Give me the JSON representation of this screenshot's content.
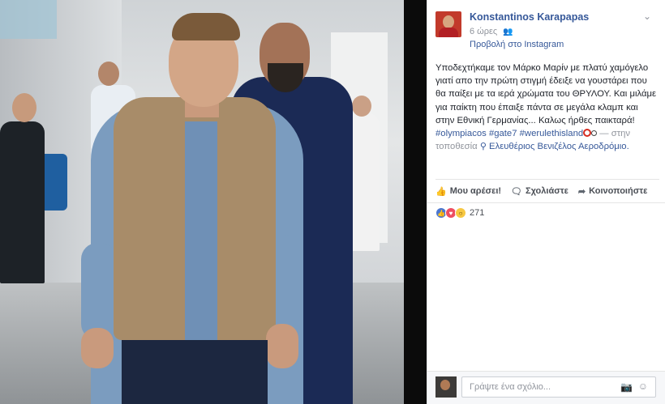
{
  "post": {
    "author": "Konstantinos Karapapas",
    "time": "6 ώρες",
    "via": "Προβολή στο Instagram",
    "text_main": "Υποδεχτήκαμε τον Μάρκο Μαρίν με πλατύ χαμόγελο γιατί απο την πρώτη στιγμή έδειξε να γουστάρει που θα παίξει με τα ιερά χρώματα του ΘΡΥΛΟΥ. Και μιλάμε για παίκτη που έπαιξε πάντα σε μεγάλα κλαμπ και στην Εθνική Γερμανίας... Καλως ήρθες παικταρά!",
    "hashtags": [
      "#olympiacos",
      "#gate7",
      "#werulethisland"
    ],
    "location_prefix": "— στην τοποθεσία",
    "location": "Ελευθέριος Βενιζέλος Αεροδρόμιο.",
    "reaction_count": "271"
  },
  "actions": {
    "like": "Μου αρέσει!",
    "comment": "Σχολιάστε",
    "share": "Κοινοποιήστε"
  },
  "comment_box": {
    "placeholder": "Γράψτε ένα σχόλιο..."
  },
  "colors": {
    "link": "#365899",
    "like": "#4a76d1",
    "love": "#ee4d61",
    "wow": "#f7c842"
  }
}
